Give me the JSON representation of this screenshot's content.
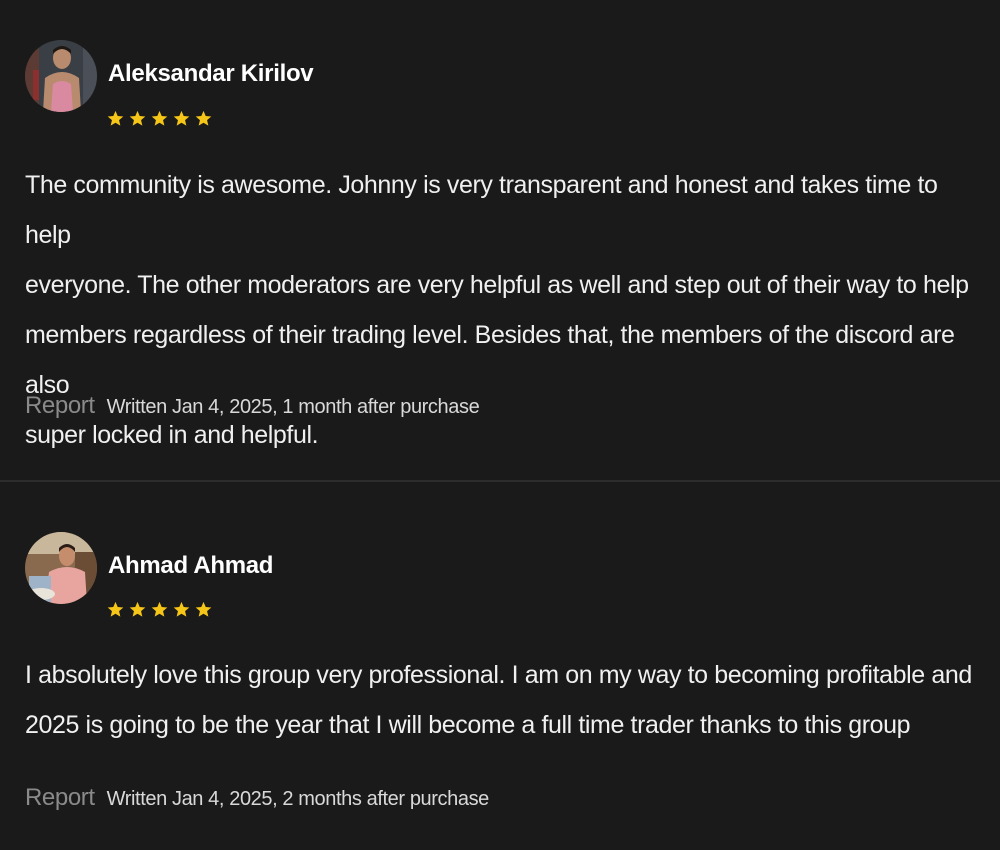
{
  "colors": {
    "background": "#1a1a1a",
    "star": "#f5c518",
    "text": "#f0f0f0",
    "muted": "#8a8a8a"
  },
  "reviews": [
    {
      "name": "Aleksandar Kirilov",
      "rating": 5,
      "avatar_icon": "person-photo-icon",
      "lines": [
        "The community is awesome. Johnny is very transparent and honest and takes time to help",
        "everyone. The other moderators are very helpful as well and step out of their way to help",
        "members regardless of their trading level. Besides that, the members of the discord are also",
        "super locked in and helpful."
      ],
      "report_label": "Report",
      "written": "Written Jan 4, 2025, 1 month after purchase"
    },
    {
      "name": "Ahmad Ahmad",
      "rating": 5,
      "avatar_icon": "person-photo-icon",
      "lines": [
        "I absolutely love this group very professional. I am on my way to becoming profitable and",
        "2025 is going to be the year that I will become a full time trader thanks to this group"
      ],
      "report_label": "Report",
      "written": "Written Jan 4, 2025, 2 months after purchase"
    }
  ]
}
